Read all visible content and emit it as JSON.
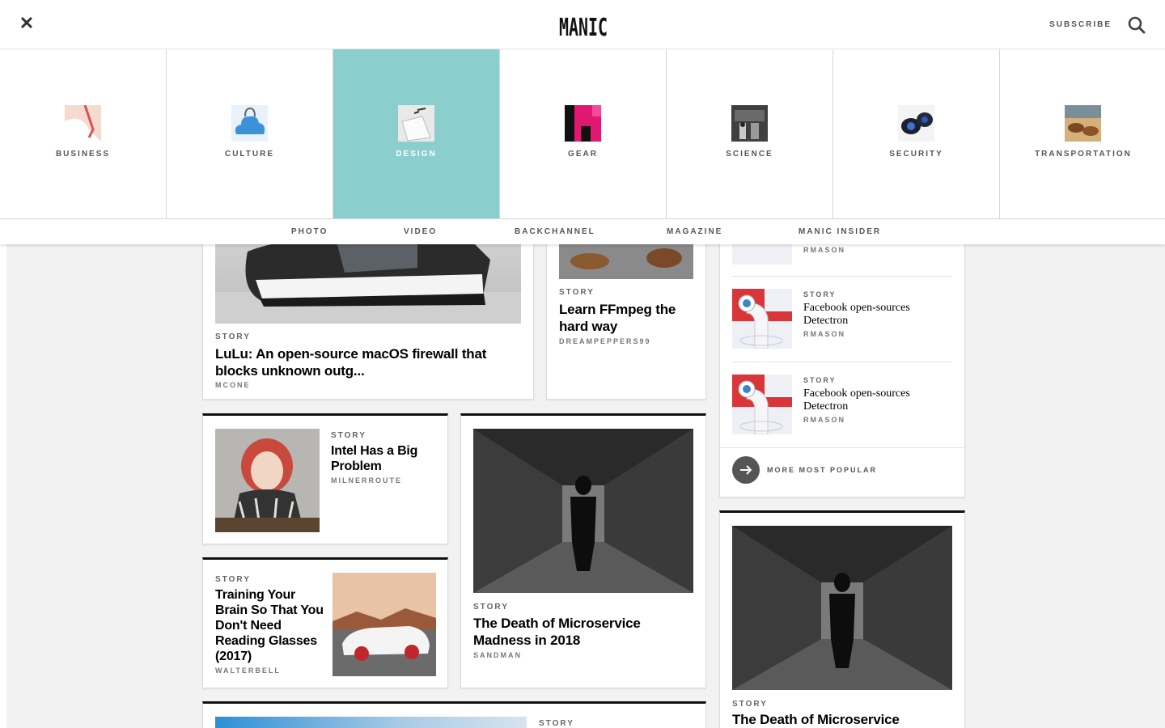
{
  "header": {
    "logo": "MANIC",
    "subscribe": "SUBSCRIBE"
  },
  "categories": [
    {
      "label": "BUSINESS"
    },
    {
      "label": "CULTURE"
    },
    {
      "label": "DESIGN",
      "active": true
    },
    {
      "label": "GEAR"
    },
    {
      "label": "SCIENCE"
    },
    {
      "label": "SECURITY"
    },
    {
      "label": "TRANSPORTATION"
    }
  ],
  "subnav": [
    "PHOTO",
    "VIDEO",
    "BACKCHANNEL",
    "MAGAZINE",
    "MANIC INSIDER"
  ],
  "feed": {
    "lulu": {
      "kicker": "STORY",
      "title": "LuLu: An open-source macOS firewall that blocks unknown outg...",
      "byline": "MCONE"
    },
    "ffmpeg": {
      "kicker": "STORY",
      "title": "Learn FFmpeg the hard way",
      "byline": "DREAMPEPPERS99"
    },
    "intel": {
      "kicker": "STORY",
      "title": "Intel Has a Big Problem",
      "byline": "MILNERROUTE"
    },
    "training": {
      "kicker": "STORY",
      "title": "Training Your Brain So That You Don't Need Reading Glasses (2017)",
      "byline": "WALTERBELL"
    },
    "microservice": {
      "kicker": "STORY",
      "title": "The Death of Microservice Madness in 2018",
      "byline": "SANDMAN"
    },
    "bottom": {
      "kicker": "STORY"
    }
  },
  "popular": {
    "top_byline": "RMASON",
    "items": [
      {
        "kicker": "STORY",
        "title": "Facebook open-sources Detectron",
        "byline": "RMASON"
      },
      {
        "kicker": "STORY",
        "title": "Facebook open-sources Detectron",
        "byline": "RMASON"
      }
    ],
    "more": "MORE MOST POPULAR"
  },
  "side": {
    "kicker": "STORY",
    "title": "The Death of Microservice"
  },
  "colors": {
    "accent": "#8acfcd",
    "rule": "#111111"
  }
}
